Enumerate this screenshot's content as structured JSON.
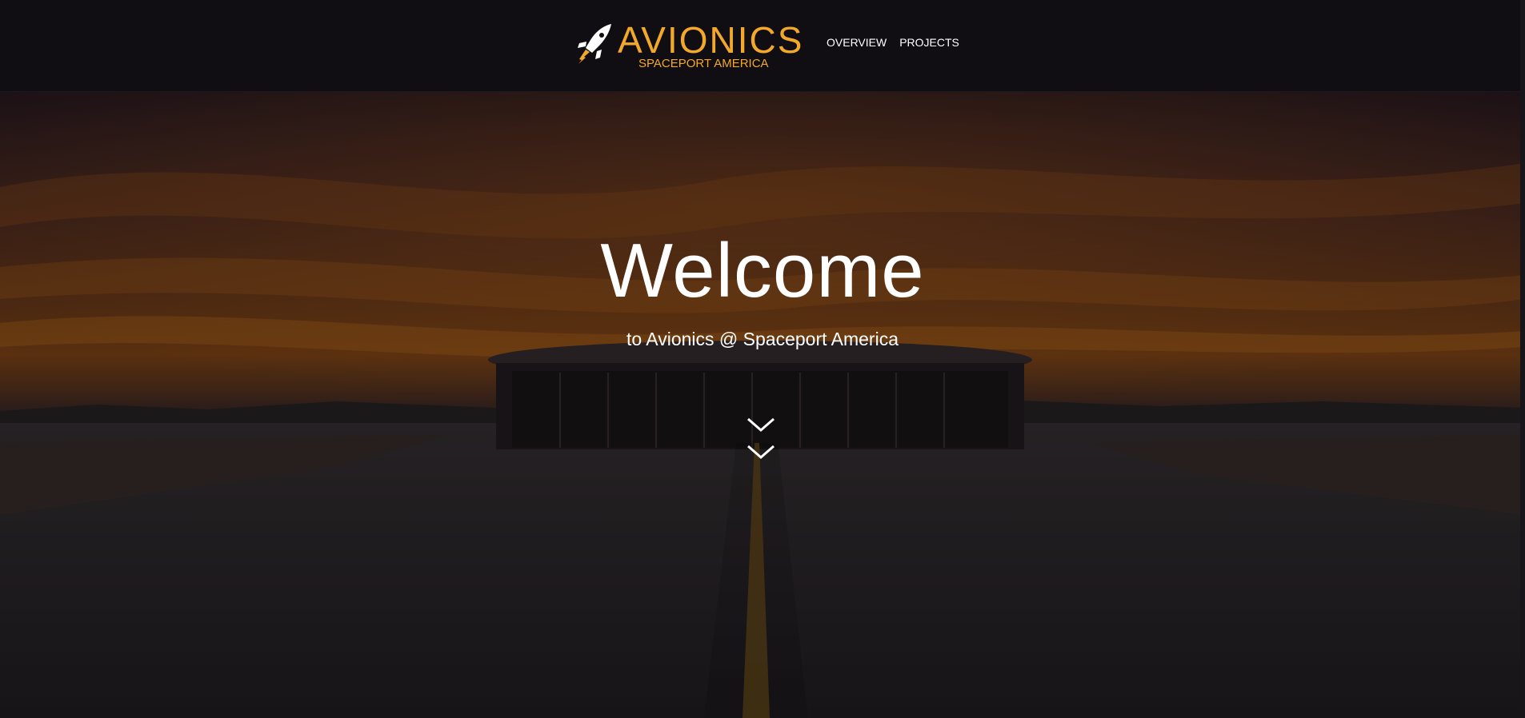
{
  "header": {
    "brand": {
      "title": "AVIONICS",
      "subtitle": "SPACEPORT AMERICA",
      "icon": "rocket-icon"
    },
    "nav": [
      {
        "label": "OVERVIEW"
      },
      {
        "label": "PROJECTS"
      }
    ]
  },
  "hero": {
    "title": "Welcome",
    "subtitle": "to Avionics @ Spaceport America",
    "scroll_icon": "double-chevron-down-icon"
  },
  "colors": {
    "accent": "#f2a82a",
    "header_bg": "#100e13",
    "text": "#ffffff"
  }
}
